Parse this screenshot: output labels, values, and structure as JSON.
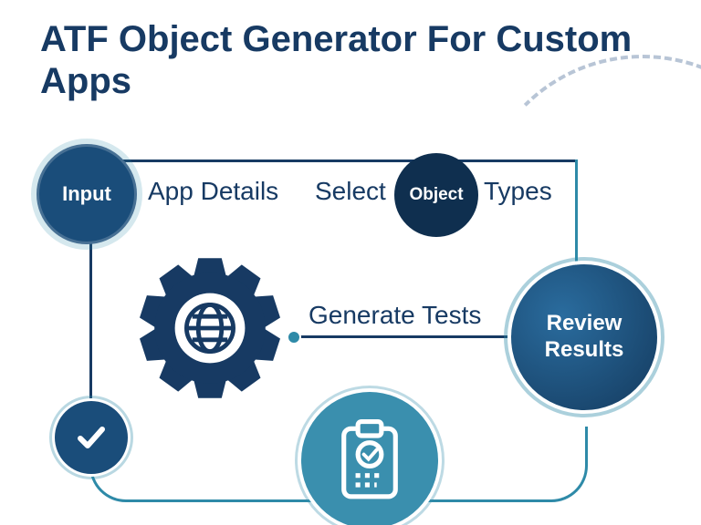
{
  "title": "ATF Object Generator For Custom Apps",
  "nodes": {
    "input": {
      "label": "Input",
      "color": "#1a4d7a"
    },
    "object": {
      "label": "Object",
      "color": "#0f2f4f"
    },
    "review": {
      "label": "Review\nResults",
      "color": "#1a4d7a"
    }
  },
  "labels": {
    "app_details": "App Details",
    "select": "Select",
    "types": "Types",
    "generate_tests": "Generate Tests"
  },
  "colors": {
    "dark_navy": "#173a63",
    "mid_blue": "#1a4d7a",
    "teal": "#2e8aa8",
    "light_teal": "#4da3bf",
    "dashed": "#b8c5d6"
  },
  "icons": {
    "gear_globe": "gear-globe-icon",
    "clipboard": "clipboard-check-icon",
    "checkmark": "checkmark-icon"
  }
}
